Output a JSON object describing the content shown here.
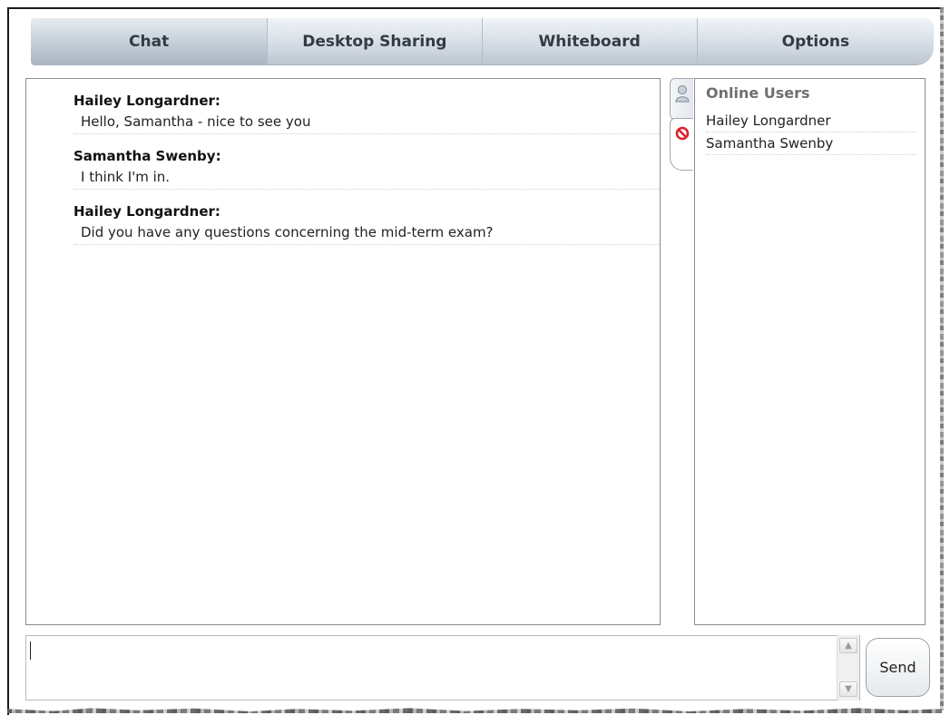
{
  "tabs": [
    {
      "label": "Chat",
      "active": true
    },
    {
      "label": "Desktop Sharing",
      "active": false
    },
    {
      "label": "Whiteboard",
      "active": false
    },
    {
      "label": "Options",
      "active": false
    }
  ],
  "chat": {
    "messages": [
      {
        "sender": "Hailey Longardner:",
        "text": "Hello, Samantha - nice to see you"
      },
      {
        "sender": "Samantha Swenby:",
        "text": "I think I'm in."
      },
      {
        "sender": "Hailey Longardner:",
        "text": "Did you have any questions concerning the mid-term exam?"
      }
    ]
  },
  "online_users": {
    "title": "Online Users",
    "users": [
      "Hailey Longardner",
      "Samantha Swenby"
    ]
  },
  "composer": {
    "value": "",
    "send_label": "Send"
  },
  "icons": {
    "user_tab": "user-icon",
    "block_tab": "no-entry-icon",
    "scroll_up": "chevron-up-icon",
    "scroll_down": "chevron-down-icon"
  },
  "colors": {
    "block_icon": "#d9232e",
    "tab_text": "#333b44"
  }
}
